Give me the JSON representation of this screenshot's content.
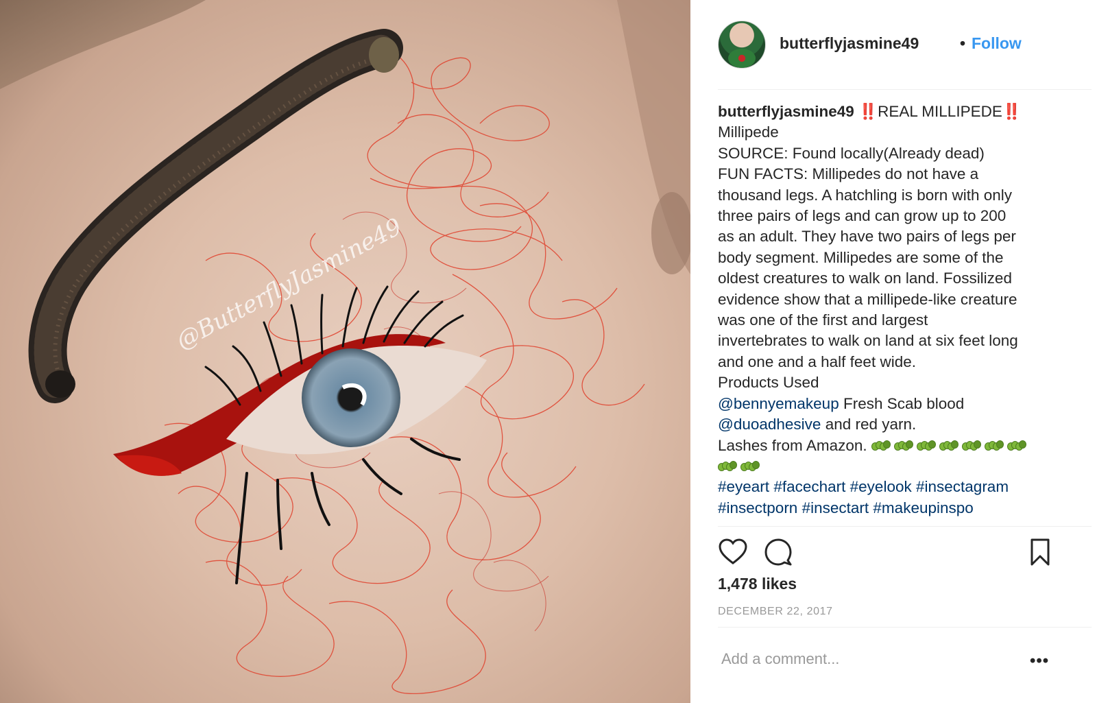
{
  "post": {
    "username": "butterflyjasmine49",
    "separator": "•",
    "follow_label": "Follow",
    "watermark": "@ButterflyJasmine49"
  },
  "caption": {
    "username": "butterflyjasmine49",
    "headline_text": "REAL MILLIPEDE",
    "bang": "‼️",
    "lines": [
      "Millipede",
      "SOURCE: Found locally(Already dead)",
      "FUN FACTS: Millipedes do not have a",
      "thousand legs. A hatchling is born with only",
      "three pairs of legs and can grow up to 200",
      "as an adult. They have two pairs of legs per",
      "body segment. Millipedes are some of the",
      "oldest creatures to walk on land. Fossilized",
      "evidence show that a millipede-like creature",
      "was one of the first and largest",
      "invertebrates to walk on land at six feet long",
      "and one and a half feet wide.",
      "Products Used"
    ],
    "mention1": "@bennyemakeup",
    "mention1_text": " Fresh Scab blood",
    "mention2": "@duoadhesive",
    "mention2_text": " and red yarn.",
    "lashes_text": "Lashes from Amazon.",
    "hashtags_line1": [
      "#eyeart",
      "#facechart",
      "#eyelook",
      "#insectagram"
    ],
    "hashtags_line2": [
      "#insectporn",
      "#insectart",
      "#makeupinspo"
    ]
  },
  "actions": {
    "like_icon": "heart-icon",
    "comment_icon": "comment-icon",
    "save_icon": "bookmark-icon"
  },
  "likes": "1,478 likes",
  "date": "DECEMBER 22, 2017",
  "comment_placeholder": "Add a comment...",
  "more_label": "•••",
  "colors": {
    "link": "#003569",
    "follow": "#3897f0",
    "muted": "#999999",
    "text": "#262626"
  }
}
